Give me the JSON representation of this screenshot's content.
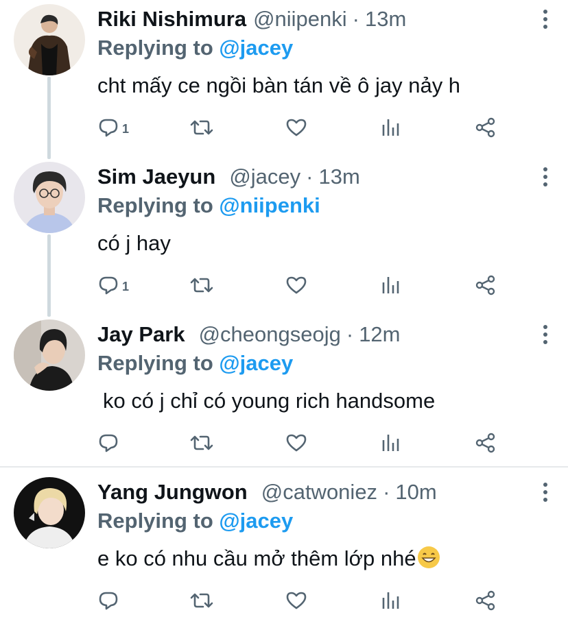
{
  "colors": {
    "mention": "#1d9bf0",
    "secondary": "#536471",
    "text": "#0f1419",
    "thread_line": "#cfd9de"
  },
  "replying_prefix": "Replying to",
  "tweets": [
    {
      "name": "Riki Nishimura",
      "handle": "@niipenki",
      "separator": "·",
      "time": "13m",
      "replying_to": "@jacey",
      "text": "cht mấy ce ngồi bàn tán về ô jay nảy h",
      "reply_count": "1",
      "avatar_icon": "avatar-photo"
    },
    {
      "name": "Sim Jaeyun",
      "handle": "@jacey",
      "separator": "·",
      "time": "13m",
      "replying_to": "@niipenki",
      "text": "có j hay",
      "reply_count": "1",
      "avatar_icon": "avatar-photo"
    },
    {
      "name": "Jay Park",
      "handle": "@cheongseojg",
      "separator": "·",
      "time": "12m",
      "replying_to": "@jacey",
      "text": "ko có j chỉ có young rich handsome",
      "reply_count": "",
      "avatar_icon": "avatar-photo"
    },
    {
      "name": "Yang Jungwon",
      "handle": "@catwoniez",
      "separator": "·",
      "time": "10m",
      "replying_to": "@jacey",
      "text": "e ko có nhu cầu mở thêm lớp nhé",
      "emoji": "grinning-face-emoji",
      "reply_count": "",
      "avatar_icon": "avatar-photo"
    }
  ],
  "action_icons": [
    "reply-icon",
    "retweet-icon",
    "like-icon",
    "analytics-icon",
    "share-icon"
  ]
}
